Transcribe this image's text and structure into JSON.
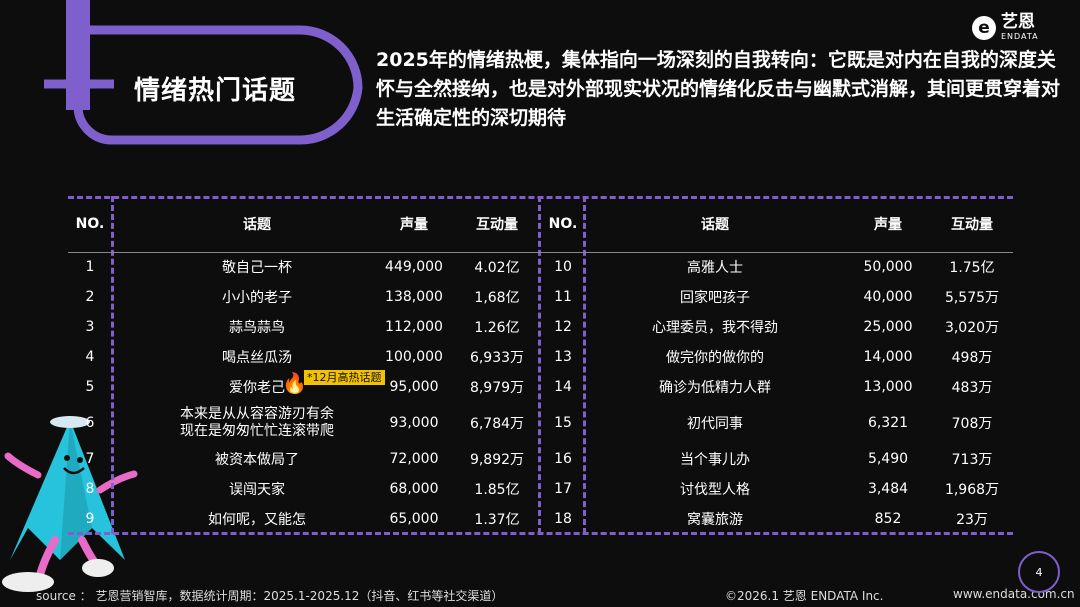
{
  "badge_title": "情绪热门话题",
  "headline": "2025年的情绪热梗，集体指向一场深刻的自我转向：它既是对内在自我的深度关怀与全然接纳，也是对外部现实状况的情绪化反击与幽默式消解，其间更贯穿着对生活确定性的深切期待",
  "logo": {
    "icon": "e-logo-icon",
    "cn": "艺恩",
    "en": "ENDATA"
  },
  "table": {
    "headers": [
      "NO.",
      "话题",
      "声量",
      "互动量"
    ],
    "left": [
      {
        "no": "1",
        "topic": "敬自己一杯",
        "volume": "449,000",
        "interact": "4.02亿"
      },
      {
        "no": "2",
        "topic": "小小的老子",
        "volume": "138,000",
        "interact": "1,68亿"
      },
      {
        "no": "3",
        "topic": "蒜鸟蒜鸟",
        "volume": "112,000",
        "interact": "1.26亿"
      },
      {
        "no": "4",
        "topic": "喝点丝瓜汤",
        "volume": "100,000",
        "interact": "6,933万"
      },
      {
        "no": "5",
        "topic": "爱你老己",
        "volume": "95,000",
        "interact": "8,979万"
      },
      {
        "no": "6",
        "topic": "本来是从从容容游刃有余",
        "topic2": "现在是匆匆忙忙连滚带爬",
        "volume": "93,000",
        "interact": "6,784万"
      },
      {
        "no": "7",
        "topic": "被资本做局了",
        "volume": "72,000",
        "interact": "9,892万"
      },
      {
        "no": "8",
        "topic": "误闯天家",
        "volume": "68,000",
        "interact": "1.85亿"
      },
      {
        "no": "9",
        "topic": "如何呢，又能怎",
        "volume": "65,000",
        "interact": "1.37亿"
      }
    ],
    "right": [
      {
        "no": "10",
        "topic": "高雅人士",
        "volume": "50,000",
        "interact": "1.75亿"
      },
      {
        "no": "11",
        "topic": "回家吧孩子",
        "volume": "40,000",
        "interact": "5,575万"
      },
      {
        "no": "12",
        "topic": "心理委员，我不得劲",
        "volume": "25,000",
        "interact": "3,020万"
      },
      {
        "no": "13",
        "topic": "做完你的做你的",
        "volume": "14,000",
        "interact": "498万"
      },
      {
        "no": "14",
        "topic": "确诊为低精力人群",
        "volume": "13,000",
        "interact": "483万"
      },
      {
        "no": "15",
        "topic": "初代同事",
        "volume": "6,321",
        "interact": "708万"
      },
      {
        "no": "16",
        "topic": "当个事儿办",
        "volume": "5,490",
        "interact": "713万"
      },
      {
        "no": "17",
        "topic": "讨伐型人格",
        "volume": "3,484",
        "interact": "1,968万"
      },
      {
        "no": "18",
        "topic": "窝囊旅游",
        "volume": "852",
        "interact": "23万"
      }
    ]
  },
  "hot_tag": "*12月高热话题",
  "hot_icon": "fire-icon",
  "footer": {
    "source": "source ： 艺恩营销智库，数据统计周期：2025.1-2025.12（抖音、红书等社交渠道）",
    "copyright": "©2026.1  艺恩 ENDATA Inc.",
    "url": "www.endata.com.cn"
  },
  "page_number": "4",
  "colors": {
    "accent": "#7e5fcc",
    "background": "#0d0d0d",
    "tag": "#f2c200",
    "fire": "#e33a2b",
    "mascot": "#27c3dc"
  }
}
